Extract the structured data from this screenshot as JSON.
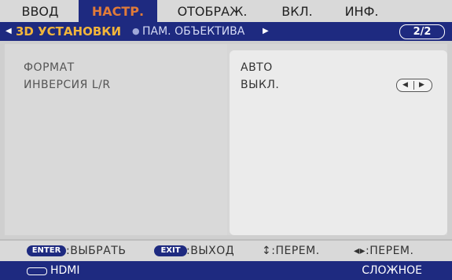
{
  "tabs": [
    {
      "label": "ВВОД"
    },
    {
      "label": "НАСТР."
    },
    {
      "label": "ОТОБРАЖ."
    },
    {
      "label": "ВКЛ."
    },
    {
      "label": "ИНФ."
    }
  ],
  "active_tab": "НАСТР.",
  "subnav": {
    "current": "3D УСТАНОВКИ",
    "next": "ПАМ. ОБЪЕКТИВА",
    "page": "2/2"
  },
  "settings": [
    {
      "label": "ФОРМАТ",
      "value": "АВТО"
    },
    {
      "label": "ИНВЕРСИЯ L/R",
      "value": "ВЫКЛ."
    }
  ],
  "help": {
    "enter_key": "ENTER",
    "enter_text": ":ВЫБРАТЬ",
    "exit_key": "EXIT",
    "exit_text": ":ВЫХОД",
    "updown_text": "↕:ПЕРЕМ.",
    "leftright_text": "◂▸:ПЕРЕМ."
  },
  "status": {
    "input": "HDMI",
    "mode": "СЛОЖНОЕ"
  },
  "colors": {
    "accent_blue": "#1e2a80",
    "active_tab_text": "#e07b39",
    "current_item_text": "#f2b53b"
  }
}
